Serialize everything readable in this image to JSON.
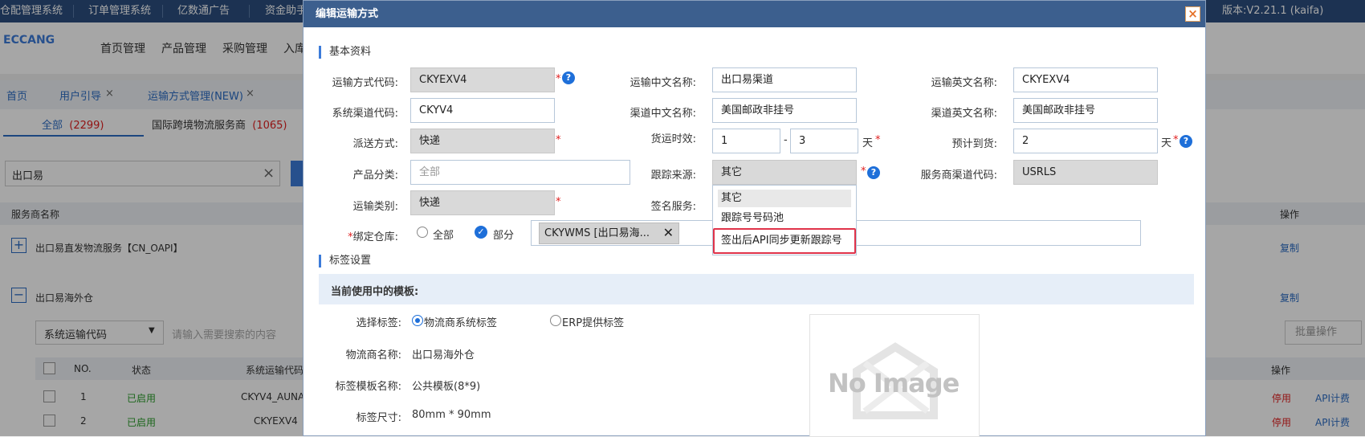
{
  "topbar": {
    "items": [
      "仓配管理系统",
      "订单管理系统",
      "亿数通广告",
      "资金助手"
    ],
    "version": "版本:V2.21.1 (kaifa)"
  },
  "header": {
    "logo": "ECCANG",
    "menu": [
      "首页管理",
      "产品管理",
      "采购管理",
      "入库"
    ]
  },
  "tabs": {
    "items": [
      "首页",
      "用户引导",
      "运输方式管理(NEW)"
    ]
  },
  "subtabs": {
    "all_label": "全部",
    "all_count": "(2299)",
    "intl_label": "国际跨境物流服务商",
    "intl_count": "(1065)"
  },
  "background": {
    "search_value": "出口易",
    "col_header": "服务商名称",
    "col_action": "操作",
    "groups": [
      "出口易直发物流服务【CN_OAPI】",
      "出口易海外仓"
    ],
    "copy_label": "复制",
    "filter_select": "系统运输代码",
    "filter_placeholder": "请输入需要搜索的内容",
    "batch_label": "批量操作",
    "table_headers": [
      "NO.",
      "状态",
      "系统运输代码",
      "操作"
    ],
    "rows": [
      {
        "no": "1",
        "status": "已启用",
        "code": "CKYV4_AUNA",
        "stop": "停用",
        "api": "API计费"
      },
      {
        "no": "2",
        "status": "已启用",
        "code": "CKYEXV4",
        "stop": "停用",
        "api": "API计费"
      }
    ]
  },
  "modal": {
    "title": "编辑运输方式",
    "close_label": "×",
    "section_basic": "基本资料",
    "section_label": "标签设置",
    "fields": {
      "code_label": "运输方式代码:",
      "code_value": "CKYEXV4",
      "cn_name_label": "运输中文名称:",
      "cn_name_value": "出口易渠道",
      "en_name_label": "运输英文名称:",
      "en_name_value": "CKYEXV4",
      "channel_code_label": "系统渠道代码:",
      "channel_code_value": "CKYV4",
      "channel_cn_label": "渠道中文名称:",
      "channel_cn_value": "美国邮政非挂号",
      "channel_en_label": "渠道英文名称:",
      "channel_en_value": "美国邮政非挂号",
      "delivery_label": "派送方式:",
      "delivery_value": "快递",
      "timeliness_label": "货运时效:",
      "timeliness_from": "1",
      "timeliness_to": "3",
      "timeliness_sep": "-",
      "day_unit": "天",
      "eta_label": "预计到货:",
      "eta_value": "2",
      "category_label": "产品分类:",
      "category_placeholder": "全部",
      "tracking_label": "跟踪来源:",
      "tracking_value": "其它",
      "provider_code_label": "服务商渠道代码:",
      "provider_code_value": "USRLS",
      "transport_type_label": "运输类别:",
      "transport_type_value": "快递",
      "sign_label": "签名服务:",
      "warehouse_label": "绑定仓库:",
      "warehouse_all": "全部",
      "warehouse_part": "部分",
      "warehouse_tag": "CKYWMS [出口易海...",
      "required_mark": "*",
      "help_mark": "?"
    },
    "tracking_options": [
      "其它",
      "跟踪号号码池",
      "签出后API同步更新跟踪号"
    ],
    "label_settings": {
      "current_template": "当前使用中的模板:",
      "select_label": "选择标签:",
      "option_logistics": "物流商系统标签",
      "option_erp": "ERP提供标签",
      "logistics_name_label": "物流商名称:",
      "logistics_name_value": "出口易海外仓",
      "template_name_label": "标签模板名称:",
      "template_name_value": "公共模板(8*9)",
      "size_label": "标签尺寸:",
      "size_value": "80mm * 90mm",
      "no_image_text": "No Image"
    }
  },
  "colors": {
    "topbar": "#2b4e7e",
    "modal_title": "#3c5f8e",
    "accent": "#1e6fd9",
    "highlight_border": "#e0334a",
    "required": "#e02020"
  }
}
